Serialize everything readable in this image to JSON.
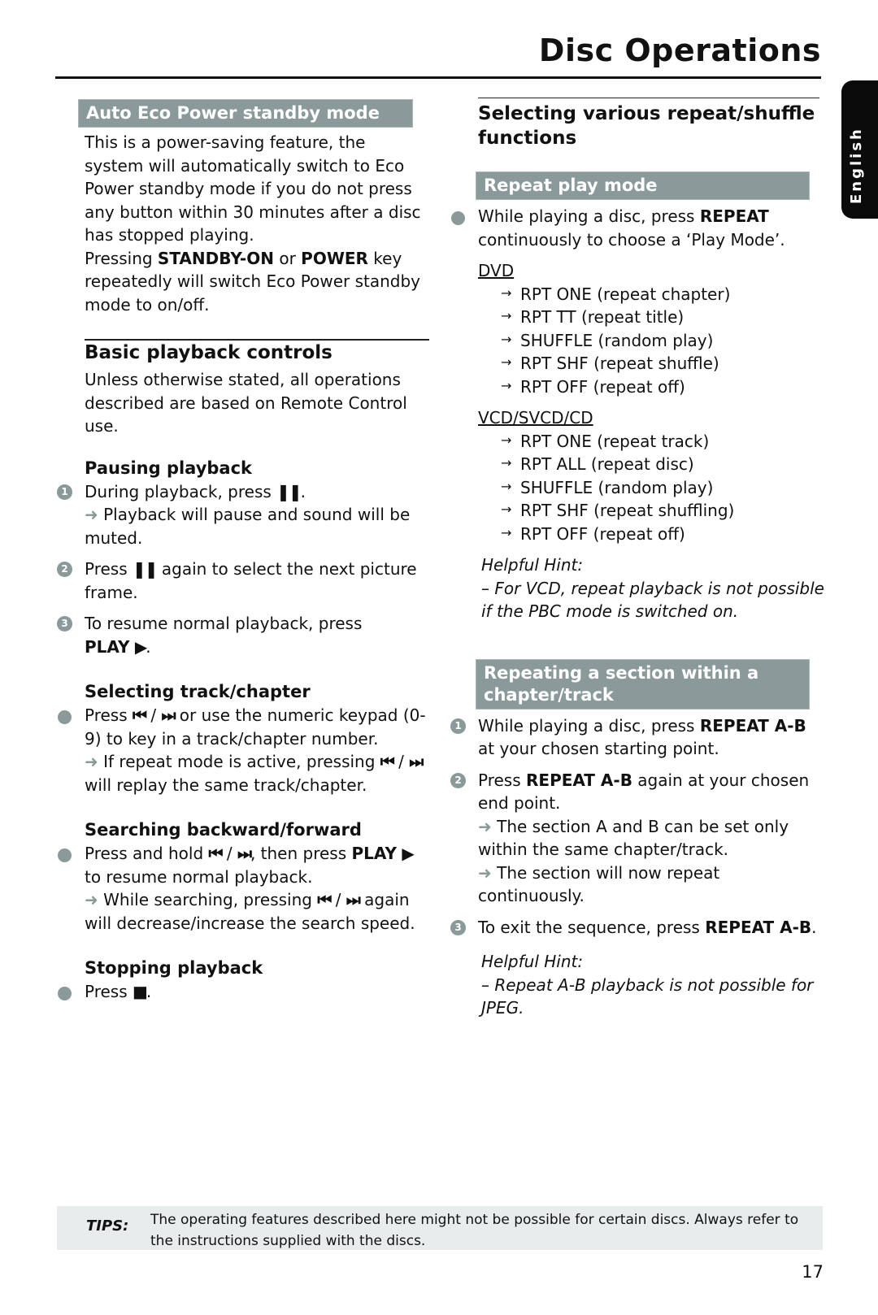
{
  "header": {
    "title": "Disc Operations",
    "language_tab": "English"
  },
  "left": {
    "eco": {
      "band": "Auto Eco Power standby mode",
      "para1": "This is a power-saving feature, the system will automatically switch to Eco Power standby mode if you do not press any button within 30 minutes after a disc has stopped playing.",
      "para2_pre": "Pressing ",
      "para2_key1": "STANDBY-ON",
      "para2_mid": " or ",
      "para2_key2": "POWER",
      "para2_post": " key repeatedly will switch Eco Power standby mode to on/off."
    },
    "basic": {
      "title": "Basic playback controls",
      "intro": "Unless otherwise stated, all operations described are based on Remote Control use."
    },
    "pausing": {
      "title": "Pausing playback",
      "steps": [
        {
          "num": "1",
          "pre": "During playback, press ",
          "icon": "❚❚",
          "post": ".",
          "arrow": "➜",
          "result": " Playback will pause and sound will be muted."
        },
        {
          "num": "2",
          "pre": "Press ",
          "icon": "❚❚",
          "post": " again to select the next picture frame."
        },
        {
          "num": "3",
          "pre": "To resume normal playback, press ",
          "key": "PLAY",
          "icon": "▶",
          "post": "."
        }
      ]
    },
    "selecting": {
      "title": "Selecting track/chapter",
      "pre": "Press ",
      "icon_prev": "⏮",
      "sep": " / ",
      "icon_next": "⏭",
      "post": " or use the numeric keypad (0-9) to key in a track/chapter number.",
      "arrow": "➜",
      "result_pre": " If repeat mode is active, pressing ",
      "result_post": " will replay the same track/chapter."
    },
    "searching": {
      "title": "Searching backward/forward",
      "pre": "Press and hold ",
      "icon_prev": "⏮",
      "sep": " / ",
      "icon_next": "⏭",
      "mid": ", then press ",
      "key": "PLAY",
      "icon_play": "▶",
      "post": " to resume normal playback.",
      "arrow": "➜",
      "result_pre": " While searching, pressing ",
      "result_post": " again will decrease/increase the search speed."
    },
    "stopping": {
      "title": "Stopping playback",
      "pre": "Press ",
      "icon": "■",
      "post": "."
    }
  },
  "right": {
    "title": "Selecting various repeat/shuffle functions",
    "repeat_band": "Repeat play mode",
    "repeat_pre": "While playing a disc, press ",
    "repeat_key": "REPEAT",
    "repeat_post": " continuously to choose a ‘Play Mode’.",
    "dvd_label": "DVD",
    "dvd_modes": [
      "RPT ONE (repeat chapter)",
      "RPT TT (repeat title)",
      "SHUFFLE (random play)",
      "RPT SHF (repeat shuffle)",
      "RPT OFF (repeat off)"
    ],
    "vcd_label": "VCD/SVCD/CD",
    "vcd_modes": [
      "RPT ONE (repeat track)",
      "RPT ALL (repeat disc)",
      "SHUFFLE (random play)",
      "RPT SHF (repeat shuffling)",
      "RPT OFF (repeat off)"
    ],
    "mode_arrow": "→",
    "hint1_title": "Helpful Hint:",
    "hint1_text": "–    For VCD, repeat playback is not possible if the PBC mode is switched on.",
    "ab_band": "Repeating a section within a chapter/track",
    "ab_steps": [
      {
        "num": "1",
        "pre": "While playing a disc, press ",
        "key": "REPEAT A-B",
        "post": " at your chosen starting point."
      },
      {
        "num": "2",
        "pre": "Press ",
        "key": "REPEAT A-B",
        "post": " again at your chosen end point.",
        "arrow": "➜",
        "result1": " The section A and B can be set only within the same chapter/track.",
        "result2": " The section will now repeat continuously."
      },
      {
        "num": "3",
        "pre": "To exit the sequence, press ",
        "key": "REPEAT A-B",
        "post": "."
      }
    ],
    "hint2_title": "Helpful Hint:",
    "hint2_text": "–    Repeat A-B playback is not possible for JPEG."
  },
  "footer": {
    "tips_label": "TIPS:",
    "tips_text": "The operating features described here might not be possible for certain discs.  Always refer to the instructions supplied with the discs.",
    "page_number": "17"
  },
  "colors": {
    "band": "#8a9a9a",
    "tips_bg": "#e9ecec",
    "text": "#111111"
  }
}
